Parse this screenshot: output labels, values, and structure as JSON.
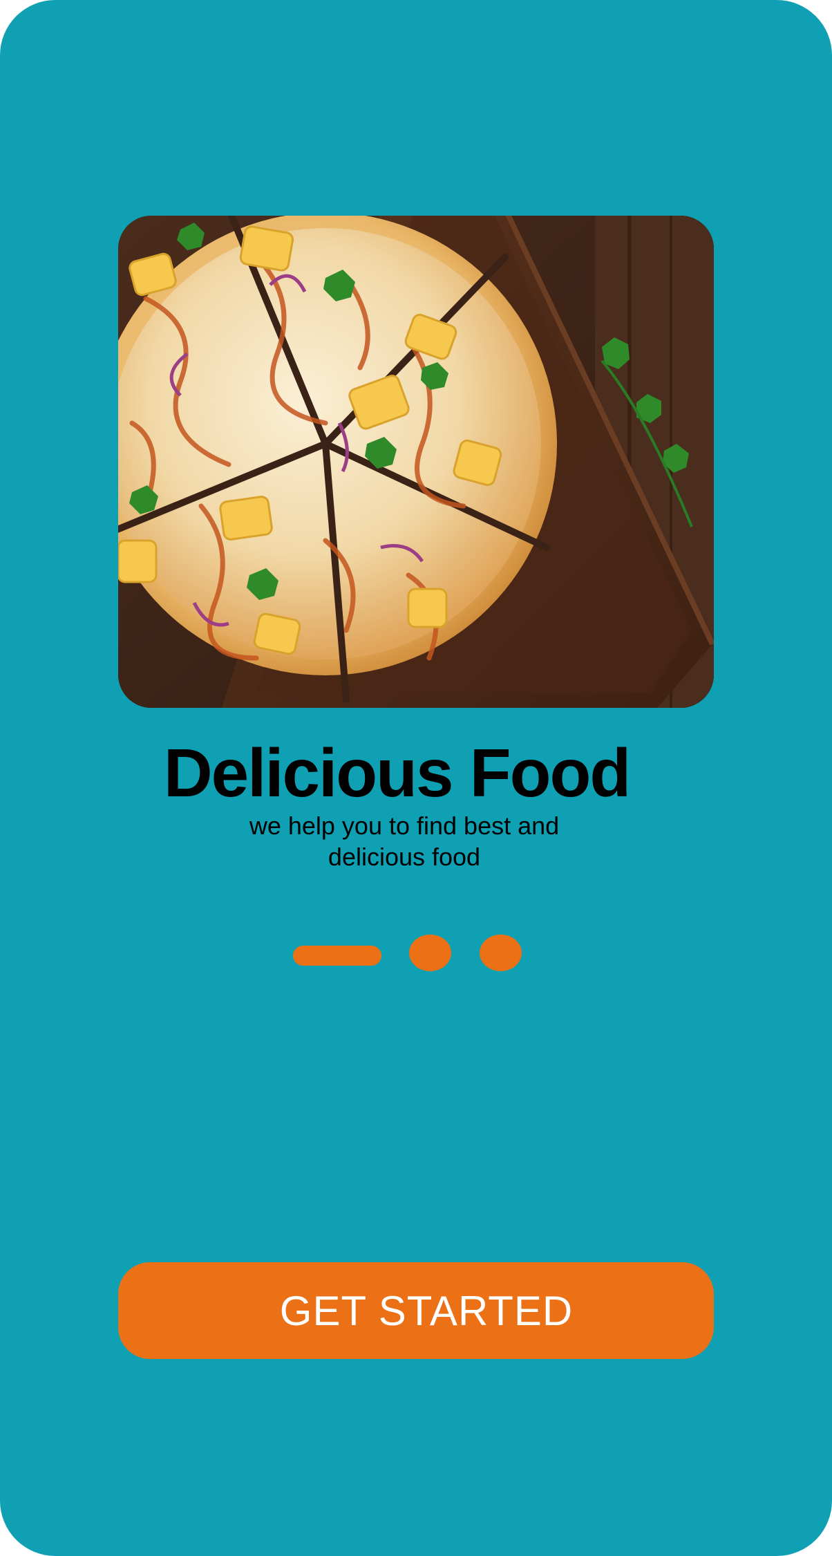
{
  "onboarding": {
    "title": "Delicious Food",
    "subtitle": "we help you to find best and delicious food",
    "cta_label": "GET STARTED",
    "pager": {
      "total_pages": 3,
      "current_page": 1
    }
  },
  "colors": {
    "background": "#0FA0B3",
    "accent": "#EB7016",
    "title_text": "#000000",
    "cta_text": "#FFFFFF"
  }
}
